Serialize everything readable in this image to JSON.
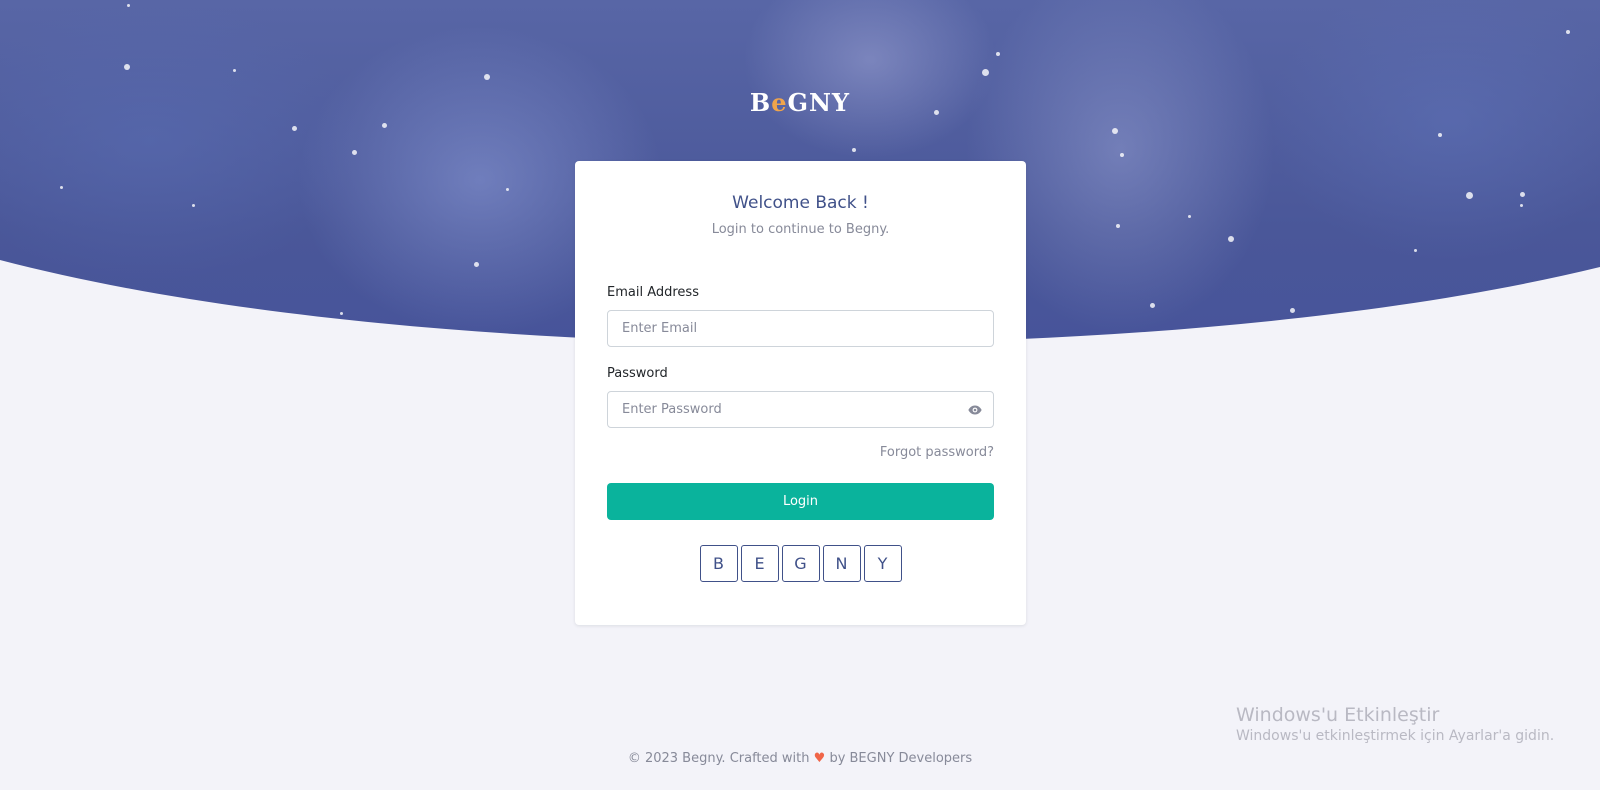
{
  "brand": {
    "logo_left": "B",
    "logo_mid": "e",
    "logo_right": "GNY"
  },
  "login": {
    "title": "Welcome Back !",
    "subtitle": "Login to continue to Begny.",
    "email_label": "Email Address",
    "email_placeholder": "Enter Email",
    "email_value": "",
    "password_label": "Password",
    "password_placeholder": "Enter Password",
    "password_value": "",
    "forgot_label": "Forgot password?",
    "login_label": "Login",
    "captcha": [
      "B",
      "E",
      "G",
      "N",
      "Y"
    ]
  },
  "footer": {
    "prefix": "© 2023 Begny. Crafted with",
    "heart": "♥",
    "suffix": "by BEGNY Developers"
  },
  "watermark": {
    "line1": "Windows'u Etkinleştir",
    "line2": "Windows'u etkinleştirmek için Ayarlar'a gidin."
  },
  "icons": {
    "password_toggle": "eye-icon",
    "footer_heart": "heart-icon"
  },
  "colors": {
    "primary": "#405189",
    "success": "#0ab39c",
    "hero": "#4a5799",
    "page_bg": "#f3f3f9",
    "heart": "#f06548"
  }
}
